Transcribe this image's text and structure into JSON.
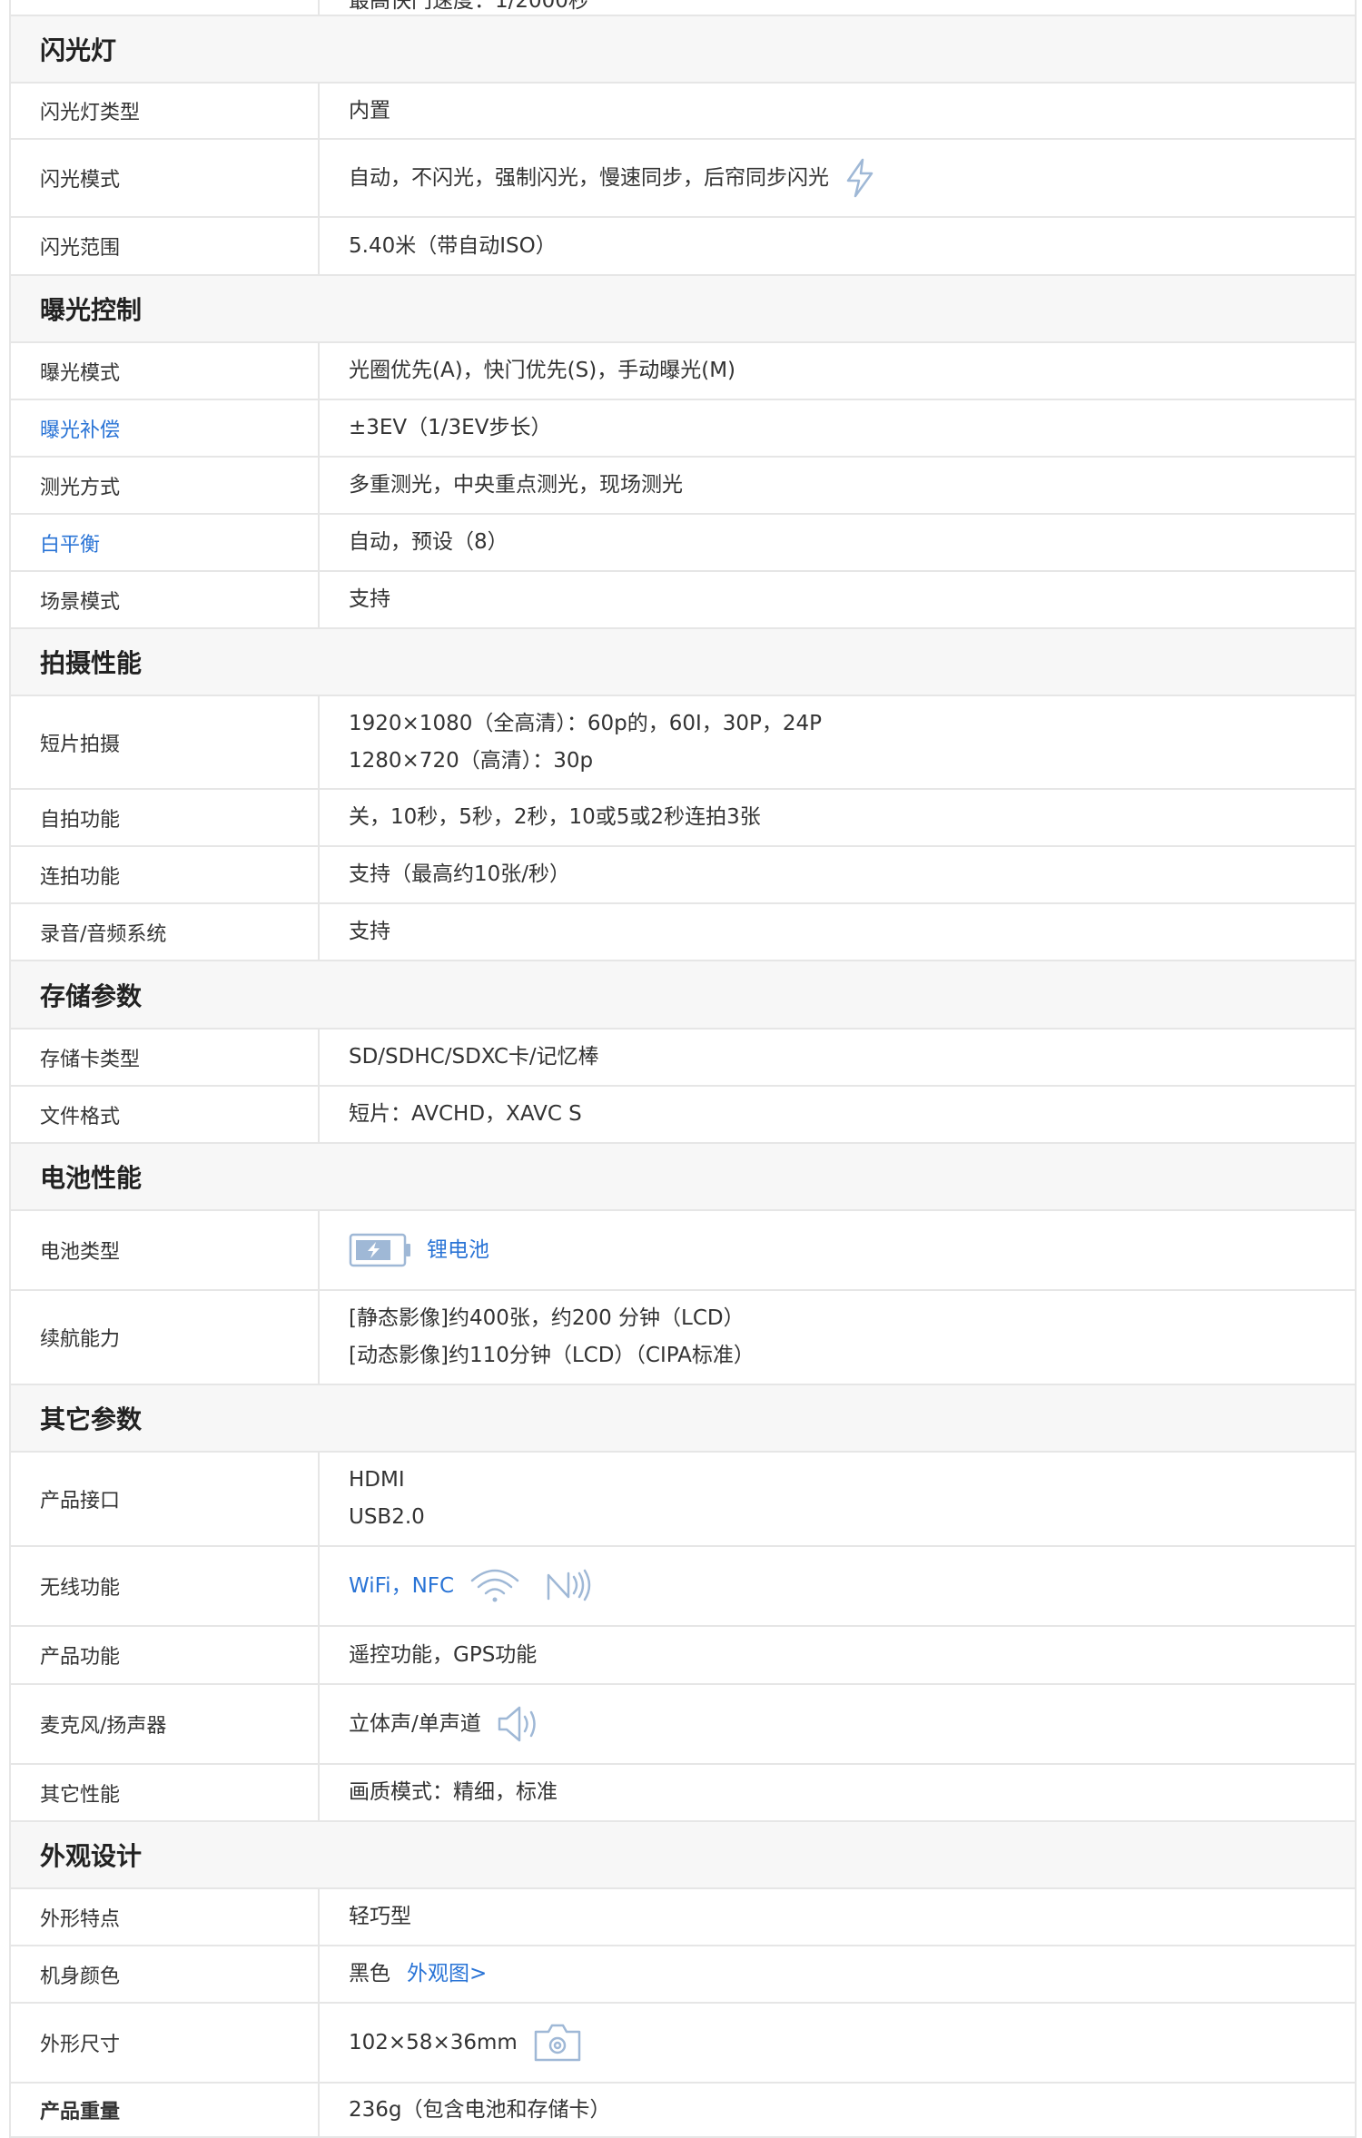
{
  "top_fragment": "最高快门速度：1/2000秒",
  "sections": {
    "flash": {
      "title": "闪光灯",
      "rows": [
        {
          "key": "闪光灯类型",
          "value": "内置"
        },
        {
          "key": "闪光模式",
          "value": "自动，不闪光，强制闪光，慢速同步，后帘同步闪光"
        },
        {
          "key": "闪光范围",
          "value": "5.40米（带自动ISO）"
        }
      ]
    },
    "exposure": {
      "title": "曝光控制",
      "rows": [
        {
          "key": "曝光模式",
          "value": "光圈优先(A)，快门优先(S)，手动曝光(M)"
        },
        {
          "key": "曝光补偿",
          "value": "±3EV（1/3EV步长）"
        },
        {
          "key": "测光方式",
          "value": "多重测光，中央重点测光，现场测光"
        },
        {
          "key": "白平衡",
          "value": "自动，预设（8）"
        },
        {
          "key": "场景模式",
          "value": "支持"
        }
      ]
    },
    "shooting": {
      "title": "拍摄性能",
      "rows": [
        {
          "key": "短片拍摄",
          "value_line1": "1920×1080（全高清）：60p的，60I，30P，24P",
          "value_line2": "1280×720（高清）：30p"
        },
        {
          "key": "自拍功能",
          "value": "关，10秒，5秒，2秒，10或5或2秒连拍3张"
        },
        {
          "key": "连拍功能",
          "value": "支持（最高约10张/秒）"
        },
        {
          "key": "录音/音频系统",
          "value": "支持"
        }
      ]
    },
    "storage": {
      "title": "存储参数",
      "rows": [
        {
          "key": "存储卡类型",
          "value": "SD/SDHC/SDXC卡/记忆棒"
        },
        {
          "key": "文件格式",
          "value": "短片：AVCHD，XAVC S"
        }
      ]
    },
    "battery": {
      "title": "电池性能",
      "rows": [
        {
          "key": "电池类型",
          "value": "锂电池"
        },
        {
          "key": "续航能力",
          "value_line1": "[静态影像]约400张，约200 分钟（LCD）",
          "value_line2": "[动态影像]约110分钟（LCD）（CIPA标准）"
        }
      ]
    },
    "other": {
      "title": "其它参数",
      "rows": [
        {
          "key": "产品接口",
          "value_line1": "HDMI",
          "value_line2": "USB2.0"
        },
        {
          "key": "无线功能",
          "value": "WiFi，NFC"
        },
        {
          "key": "产品功能",
          "value": "遥控功能，GPS功能"
        },
        {
          "key": "麦克风/扬声器",
          "value": "立体声/单声道"
        },
        {
          "key": "其它性能",
          "value": "画质模式：精细，标准"
        }
      ]
    },
    "design": {
      "title": "外观设计",
      "rows": [
        {
          "key": "外形特点",
          "value": "轻巧型"
        },
        {
          "key": "机身颜色",
          "value": "黑色",
          "link": "外观图>"
        },
        {
          "key": "外形尺寸",
          "value": "102×58×36mm"
        },
        {
          "key": "产品重量",
          "value": "236g（包含电池和存储卡）"
        }
      ]
    }
  },
  "icons": {
    "flash": "flash-bolt-icon",
    "battery": "battery-icon",
    "wifi": "wifi-icon",
    "nfc": "nfc-icon",
    "speaker": "speaker-icon",
    "camera": "camera-icon"
  },
  "colors": {
    "link": "#2a74d6",
    "section_bg": "#f7f7f7",
    "border": "#e6e6e6",
    "icon": "#9fb8d6"
  }
}
